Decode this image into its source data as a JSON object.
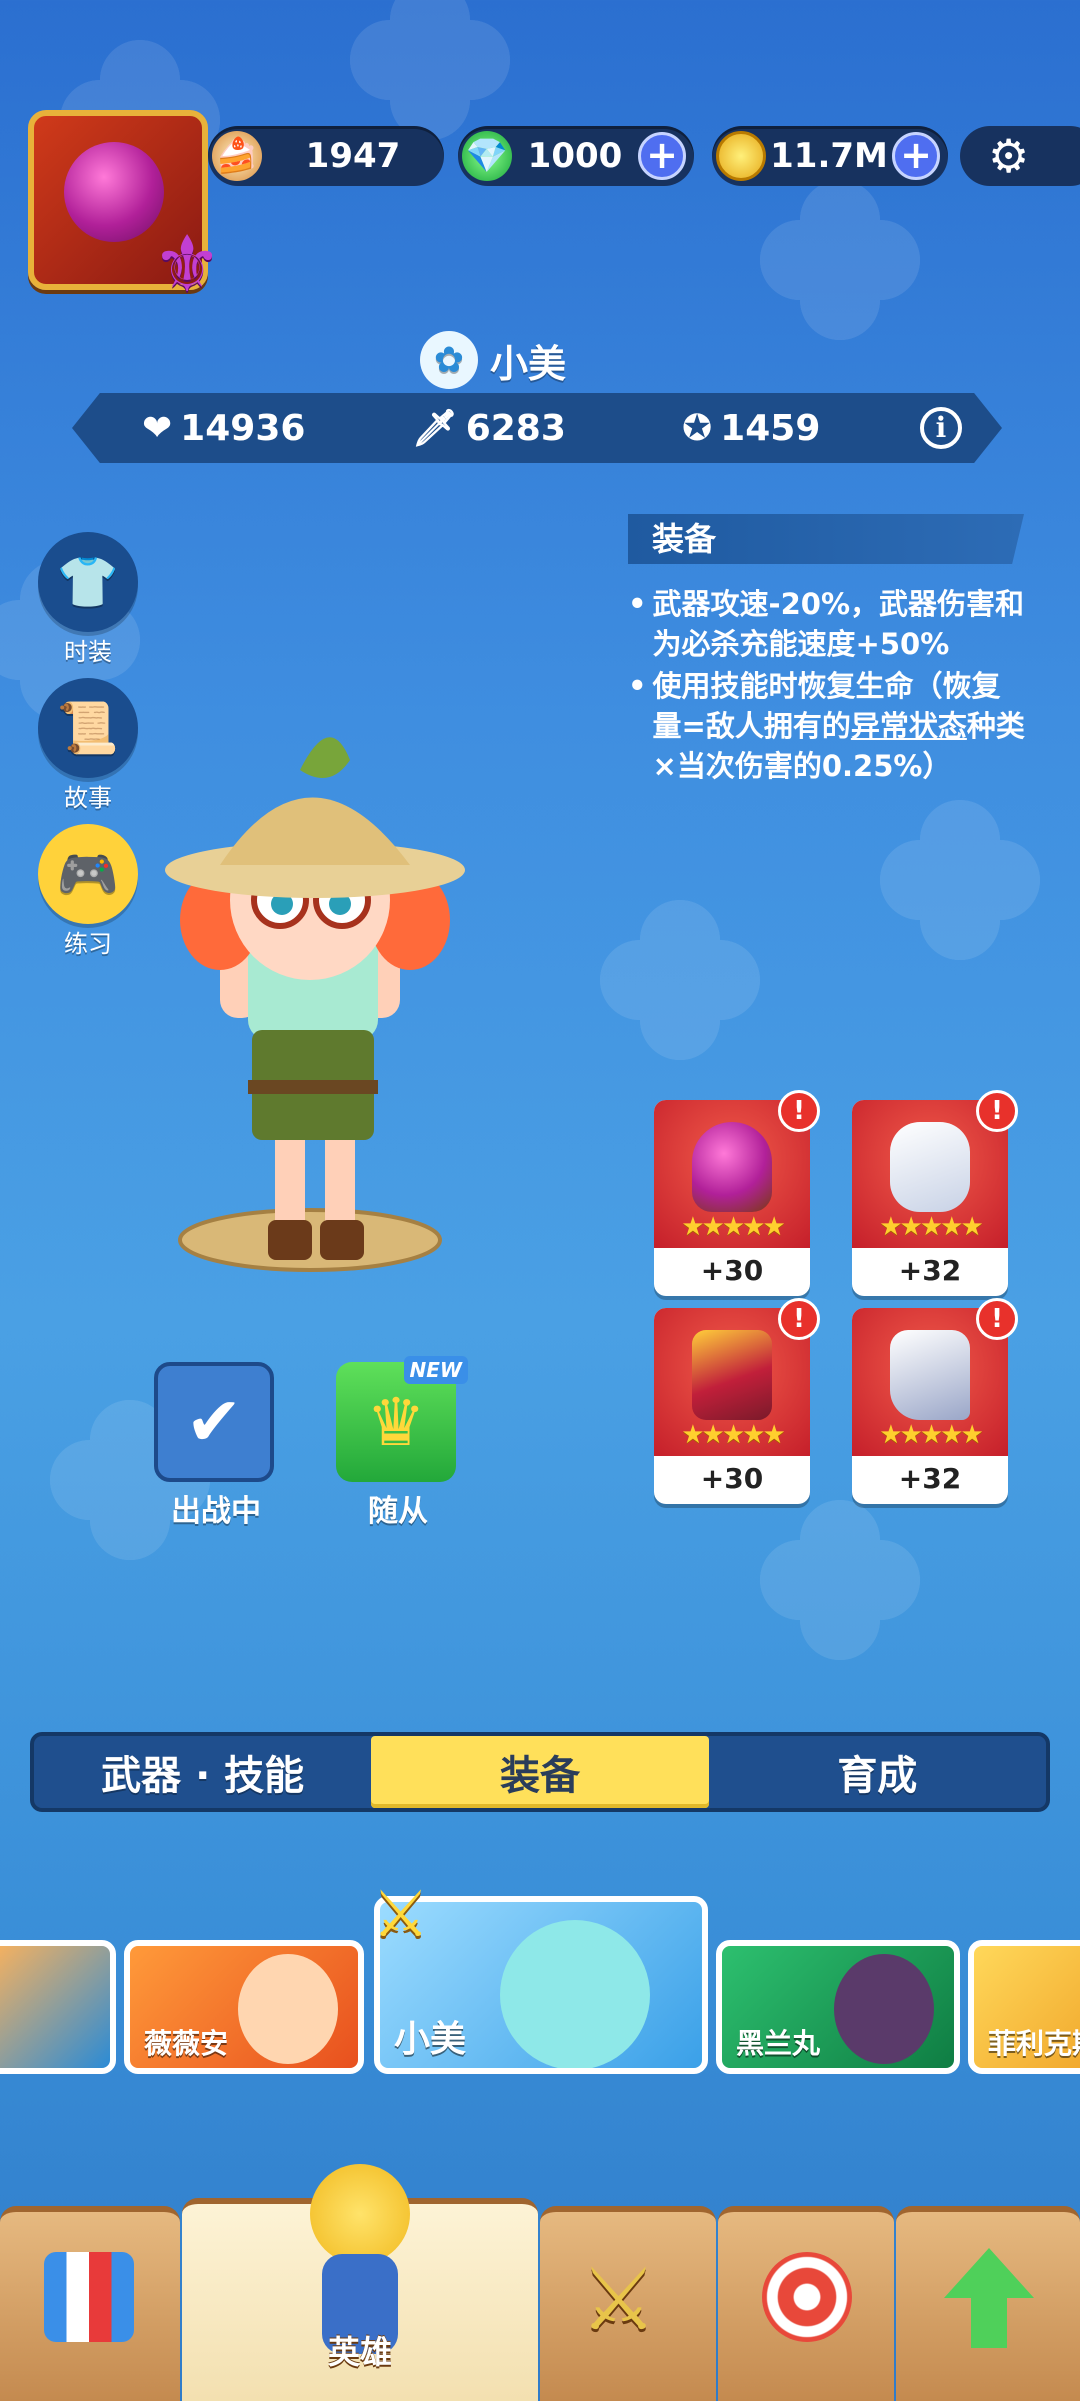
{
  "top_bar": {
    "resources": [
      {
        "icon": "cake-icon",
        "value": "1947",
        "has_plus": false
      },
      {
        "icon": "gem-icon",
        "value": "1000",
        "has_plus": true
      },
      {
        "icon": "coin-icon",
        "value": "11.7M",
        "has_plus": true
      }
    ],
    "plus_symbol": "+",
    "settings_icon": "⚙"
  },
  "hero": {
    "name": "小美",
    "stats": {
      "health": "14936",
      "attack": "6283",
      "power": "1459"
    },
    "info_symbol": "i"
  },
  "side_buttons": [
    {
      "label": "时装",
      "icon": "shirt-icon",
      "glyph": "👕"
    },
    {
      "label": "故事",
      "icon": "scroll-icon",
      "glyph": "📜"
    },
    {
      "label": "练习",
      "icon": "gamepad-icon",
      "glyph": "🎮"
    }
  ],
  "equipment_panel": {
    "header": "装备",
    "bullets": [
      "武器攻速-20%，武器伤害和为必杀充能速度+50%",
      "使用技能时恢复生命（恢复量=敌人拥有的异常状态种类×当次伤害的0.25%）"
    ],
    "underlined_term": "异常状态"
  },
  "equipment": [
    {
      "name": "helmet",
      "level": "+30",
      "stars": "★★★★★",
      "alert": "!"
    },
    {
      "name": "gloves",
      "level": "+32",
      "stars": "★★★★★",
      "alert": "!"
    },
    {
      "name": "armor",
      "level": "+30",
      "stars": "★★★★★",
      "alert": "!"
    },
    {
      "name": "boots",
      "level": "+32",
      "stars": "★★★★★",
      "alert": "!"
    }
  ],
  "action_buttons": {
    "deployed": {
      "label": "出战中",
      "checkmark": "✔"
    },
    "follower": {
      "label": "随从",
      "badge": "NEW"
    }
  },
  "tabs": [
    {
      "label": "武器 · 技能",
      "active": false
    },
    {
      "label": "装备",
      "active": true
    },
    {
      "label": "育成",
      "active": false
    }
  ],
  "hero_carousel": [
    {
      "name": "",
      "color": "#2a8bd6"
    },
    {
      "name": "薇薇安",
      "color": "#f06a2a"
    },
    {
      "name": "小美",
      "color": "#4fb7ef",
      "selected": true
    },
    {
      "name": "黑兰丸",
      "color": "#1fa563"
    },
    {
      "name": "菲利克斯",
      "color": "#f6c23c"
    }
  ],
  "bottom_nav": [
    {
      "label": "",
      "icon": "shop-icon"
    },
    {
      "label": "英雄",
      "icon": "hero-icon",
      "active": true
    },
    {
      "label": "",
      "icon": "battle-icon"
    },
    {
      "label": "",
      "icon": "target-icon"
    },
    {
      "label": "",
      "icon": "upgrade-icon"
    }
  ],
  "colors": {
    "accent_yellow": "#ffe05a",
    "panel_dark": "#17325f",
    "card_red": "#d9342d"
  }
}
